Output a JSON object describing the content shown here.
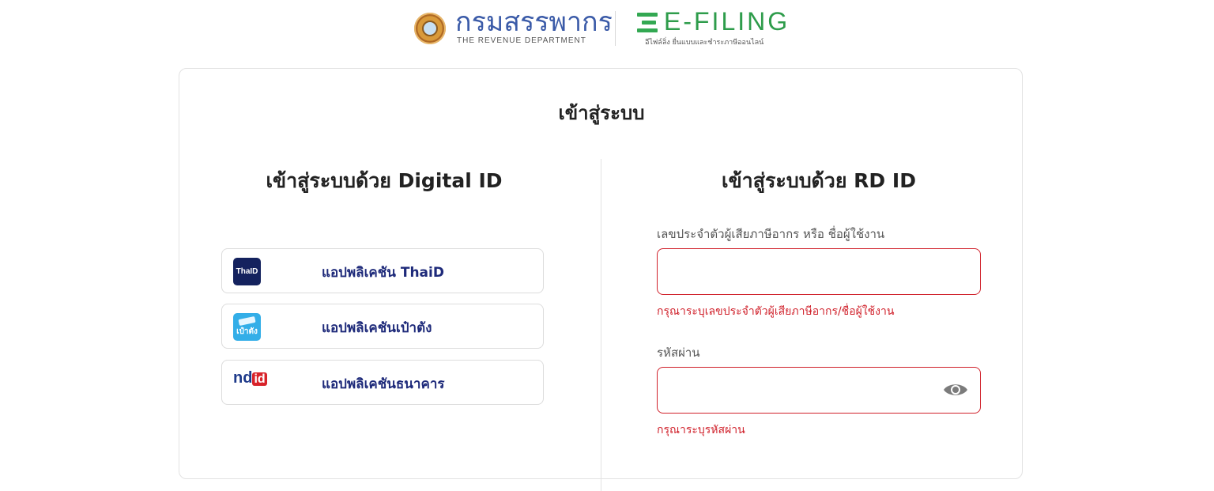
{
  "header": {
    "rd_logo_name": "กรมสรรพากร",
    "rd_logo_sub": "THE REVENUE DEPARTMENT",
    "efiling_name": "E-FILING",
    "efiling_sub": "อีไฟล์ลิ่ง ยื่นแบบและชำระภาษีออนไลน์"
  },
  "card": {
    "title": "เข้าสู่ระบบ"
  },
  "digital_id": {
    "title": "เข้าสู่ระบบด้วย Digital ID",
    "apps": [
      {
        "label": "แอปพลิเคชัน ThaiD",
        "icon": "thaid-icon",
        "icon_text": "ThaID"
      },
      {
        "label": "แอปพลิเคชันเป๋าตัง",
        "icon": "paotang-icon",
        "icon_text": "เป๋าตัง"
      },
      {
        "label": "แอปพลิเคชันธนาคาร",
        "icon": "ndid-icon",
        "icon_text": "ndid"
      }
    ]
  },
  "rd_id": {
    "title": "เข้าสู่ระบบด้วย RD ID",
    "username_label": "เลขประจำตัวผู้เสียภาษีอากร หรือ ชื่อผู้ใช้งาน",
    "username_value": "",
    "username_error": "กรุณาระบุเลขประจำตัวผู้เสียภาษีอากร/ชื่อผู้ใช้งาน",
    "password_label": "รหัสผ่าน",
    "password_value": "",
    "password_error": "กรุณาระบุรหัสผ่าน",
    "password_toggle_icon": "eye-icon"
  },
  "colors": {
    "error": "#d0202a",
    "app_label": "#1e2a7a",
    "efiling_green": "#2e9c4b",
    "rd_blue": "#3b5ba8"
  }
}
